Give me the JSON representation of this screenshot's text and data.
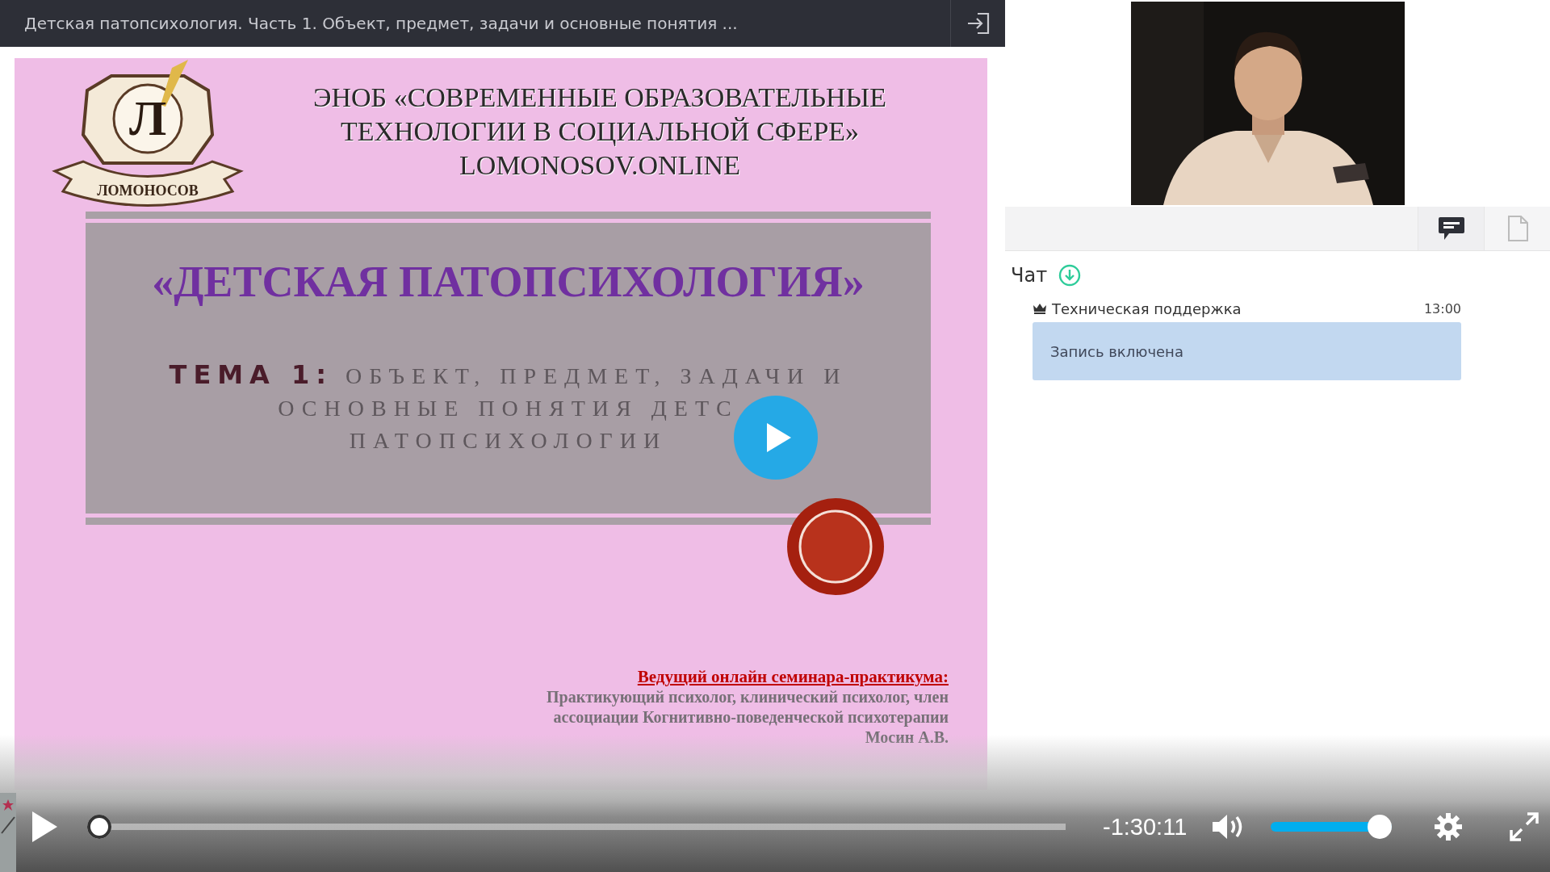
{
  "header": {
    "title": "Детская патопсихология. Часть 1. Объект, предмет, задачи и основные понятия ..."
  },
  "slide": {
    "logo": {
      "letter": "Л",
      "ribbon": "ЛОМОНОСОВ"
    },
    "org_lines": [
      "ЭНОБ «СОВРЕМЕННЫЕ ОБРАЗОВАТЕЛЬНЫЕ",
      "ТЕХНОЛОГИИ В СОЦИАЛЬНОЙ СФЕРЕ»",
      "LOMONOSOV.ONLINE"
    ],
    "title": "«ДЕТСКАЯ ПАТОПСИХОЛОГИЯ»",
    "topic_label": "ТЕМА 1:",
    "topic_lines": [
      "ОБЪЕКТ, ПРЕДМЕТ, ЗАДАЧИ И",
      "ОСНОВНЫЕ ПОНЯТИЯ ДЕТС",
      "ПАТОПСИХОЛОГИИ"
    ],
    "presenter_heading": "Ведущий онлайн семинара-практикума:",
    "presenter_lines": [
      "Практикующий психолог, клинический психолог, член",
      "ассоциации Когнитивно-поведенческой психотерапии",
      "Мосин А.В."
    ]
  },
  "side_tabs": [
    {
      "kind": "chat",
      "selected": true
    },
    {
      "kind": "files",
      "selected": false
    }
  ],
  "chat": {
    "title": "Чат",
    "messages": [
      {
        "author": "Техническая поддержка",
        "time": "13:00",
        "text": "Запись включена"
      }
    ]
  },
  "player": {
    "progress": {
      "level": 0
    },
    "remaining": "-1:30:11",
    "volume": {
      "level": 1
    }
  }
}
